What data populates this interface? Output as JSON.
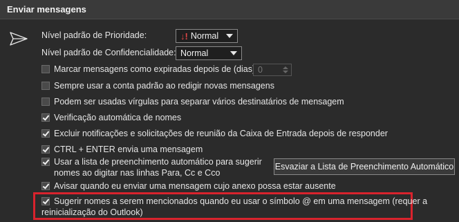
{
  "section": {
    "title": "Enviar mensagens"
  },
  "icons": {
    "send": "send-paper-plane-icon",
    "priority": "priority-high-icon"
  },
  "priority": {
    "label": "Nível padrão de Prioridade:",
    "value": "Normal",
    "icon_glyph": "↓!"
  },
  "confidentiality": {
    "label": "Nível padrão de Confidencialidade:",
    "value": "Normal"
  },
  "options": [
    {
      "label": "Marcar mensagens como expiradas depois de (dias):",
      "checked": false
    },
    {
      "label": "Sempre usar a conta padrão ao redigir novas mensagens",
      "checked": false
    },
    {
      "label": "Podem ser usadas vírgulas para separar vários destinatários de mensagem",
      "checked": false
    },
    {
      "label": "Verificação automática de nomes",
      "checked": true
    },
    {
      "label": "Excluir notificações e solicitações de reunião da Caixa de Entrada depois de responder",
      "checked": true
    },
    {
      "label": "CTRL + ENTER envia uma mensagem",
      "checked": true
    },
    {
      "label_line1": "Usar a lista de preenchimento automático para sugerir",
      "label_line2": "nomes ao digitar nas linhas Para, Cc e Cco",
      "checked": true
    },
    {
      "label": "Avisar quando eu enviar uma mensagem cujo anexo possa estar ausente",
      "checked": true
    },
    {
      "label_line1": "Sugerir nomes a serem mencionados quando eu usar o símbolo @ em uma mensagem (requer a",
      "label_line2": "reinicialização do Outlook)",
      "checked": true
    }
  ],
  "expire_days": {
    "value": "0"
  },
  "clear_autocomplete_button": {
    "label": "Esvaziar a Lista de Preenchimento Automático"
  },
  "colors": {
    "background": "#2b2b2b",
    "header": "#3a3a3a",
    "highlight_border": "#d9232d",
    "priority_icon": "#e04646"
  }
}
